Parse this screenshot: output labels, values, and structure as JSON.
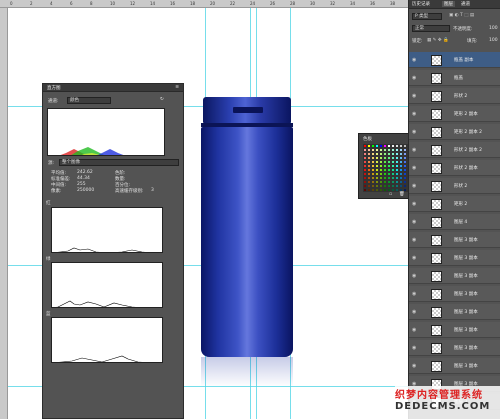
{
  "rulers": {
    "ticks": [
      "0",
      "2",
      "4",
      "6",
      "8",
      "10",
      "12",
      "14",
      "16",
      "18",
      "20",
      "22",
      "24",
      "26",
      "28",
      "30",
      "32",
      "34",
      "36",
      "38",
      "40"
    ]
  },
  "histogram": {
    "tabs": [
      "直方图",
      ""
    ],
    "channel_label": "通道:",
    "channel_value": "颜色",
    "source_label": "源:",
    "source_value": "整个图像",
    "stats_left": [
      {
        "label": "平均值:",
        "value": "242.62"
      },
      {
        "label": "标准偏差:",
        "value": "44.34"
      },
      {
        "label": "中间值:",
        "value": "255"
      },
      {
        "label": "像素:",
        "value": "250000"
      }
    ],
    "stats_right": [
      {
        "label": "色阶:",
        "value": ""
      },
      {
        "label": "数量:",
        "value": ""
      },
      {
        "label": "百分位:",
        "value": ""
      },
      {
        "label": "高速缓存级别:",
        "value": "3"
      }
    ],
    "channels": [
      "红",
      "绿",
      "蓝"
    ]
  },
  "swatches_panel": {
    "title": "色板"
  },
  "layers_panel": {
    "tabs": [
      "历史记录",
      "图层",
      "通道"
    ],
    "kind_label": "P 类型",
    "blend_mode": "正常",
    "opacity_label": "不透明度:",
    "opacity_value": "100",
    "lock_label": "锁定:",
    "fill_label": "填充:",
    "fill_value": "100",
    "layers": [
      {
        "name": "瓶盖 副本",
        "selected": true
      },
      {
        "name": "瓶盖",
        "selected": false
      },
      {
        "name": "形状 2",
        "selected": false
      },
      {
        "name": "矩形 2 副本",
        "selected": false
      },
      {
        "name": "矩形 2 副本 2",
        "selected": false
      },
      {
        "name": "形状 2 副本 2",
        "selected": false
      },
      {
        "name": "形状 2 副本",
        "selected": false
      },
      {
        "name": "形状 2",
        "selected": false
      },
      {
        "name": "矩形 2",
        "selected": false
      },
      {
        "name": "图层 4",
        "selected": false
      },
      {
        "name": "图层 3 副本",
        "selected": false
      },
      {
        "name": "图层 3 副本",
        "selected": false
      },
      {
        "name": "图层 3 副本",
        "selected": false
      },
      {
        "name": "图层 3 副本",
        "selected": false
      },
      {
        "name": "图层 3 副本",
        "selected": false
      },
      {
        "name": "图层 3 副本",
        "selected": false
      },
      {
        "name": "图层 3 副本",
        "selected": false
      },
      {
        "name": "图层 3 副本",
        "selected": false
      },
      {
        "name": "图层 3 副本",
        "selected": false
      },
      {
        "name": "图层 3",
        "selected": false
      }
    ]
  },
  "watermark": {
    "line1": "织梦内容管理系统",
    "line2": "DEDECMS.COM"
  }
}
